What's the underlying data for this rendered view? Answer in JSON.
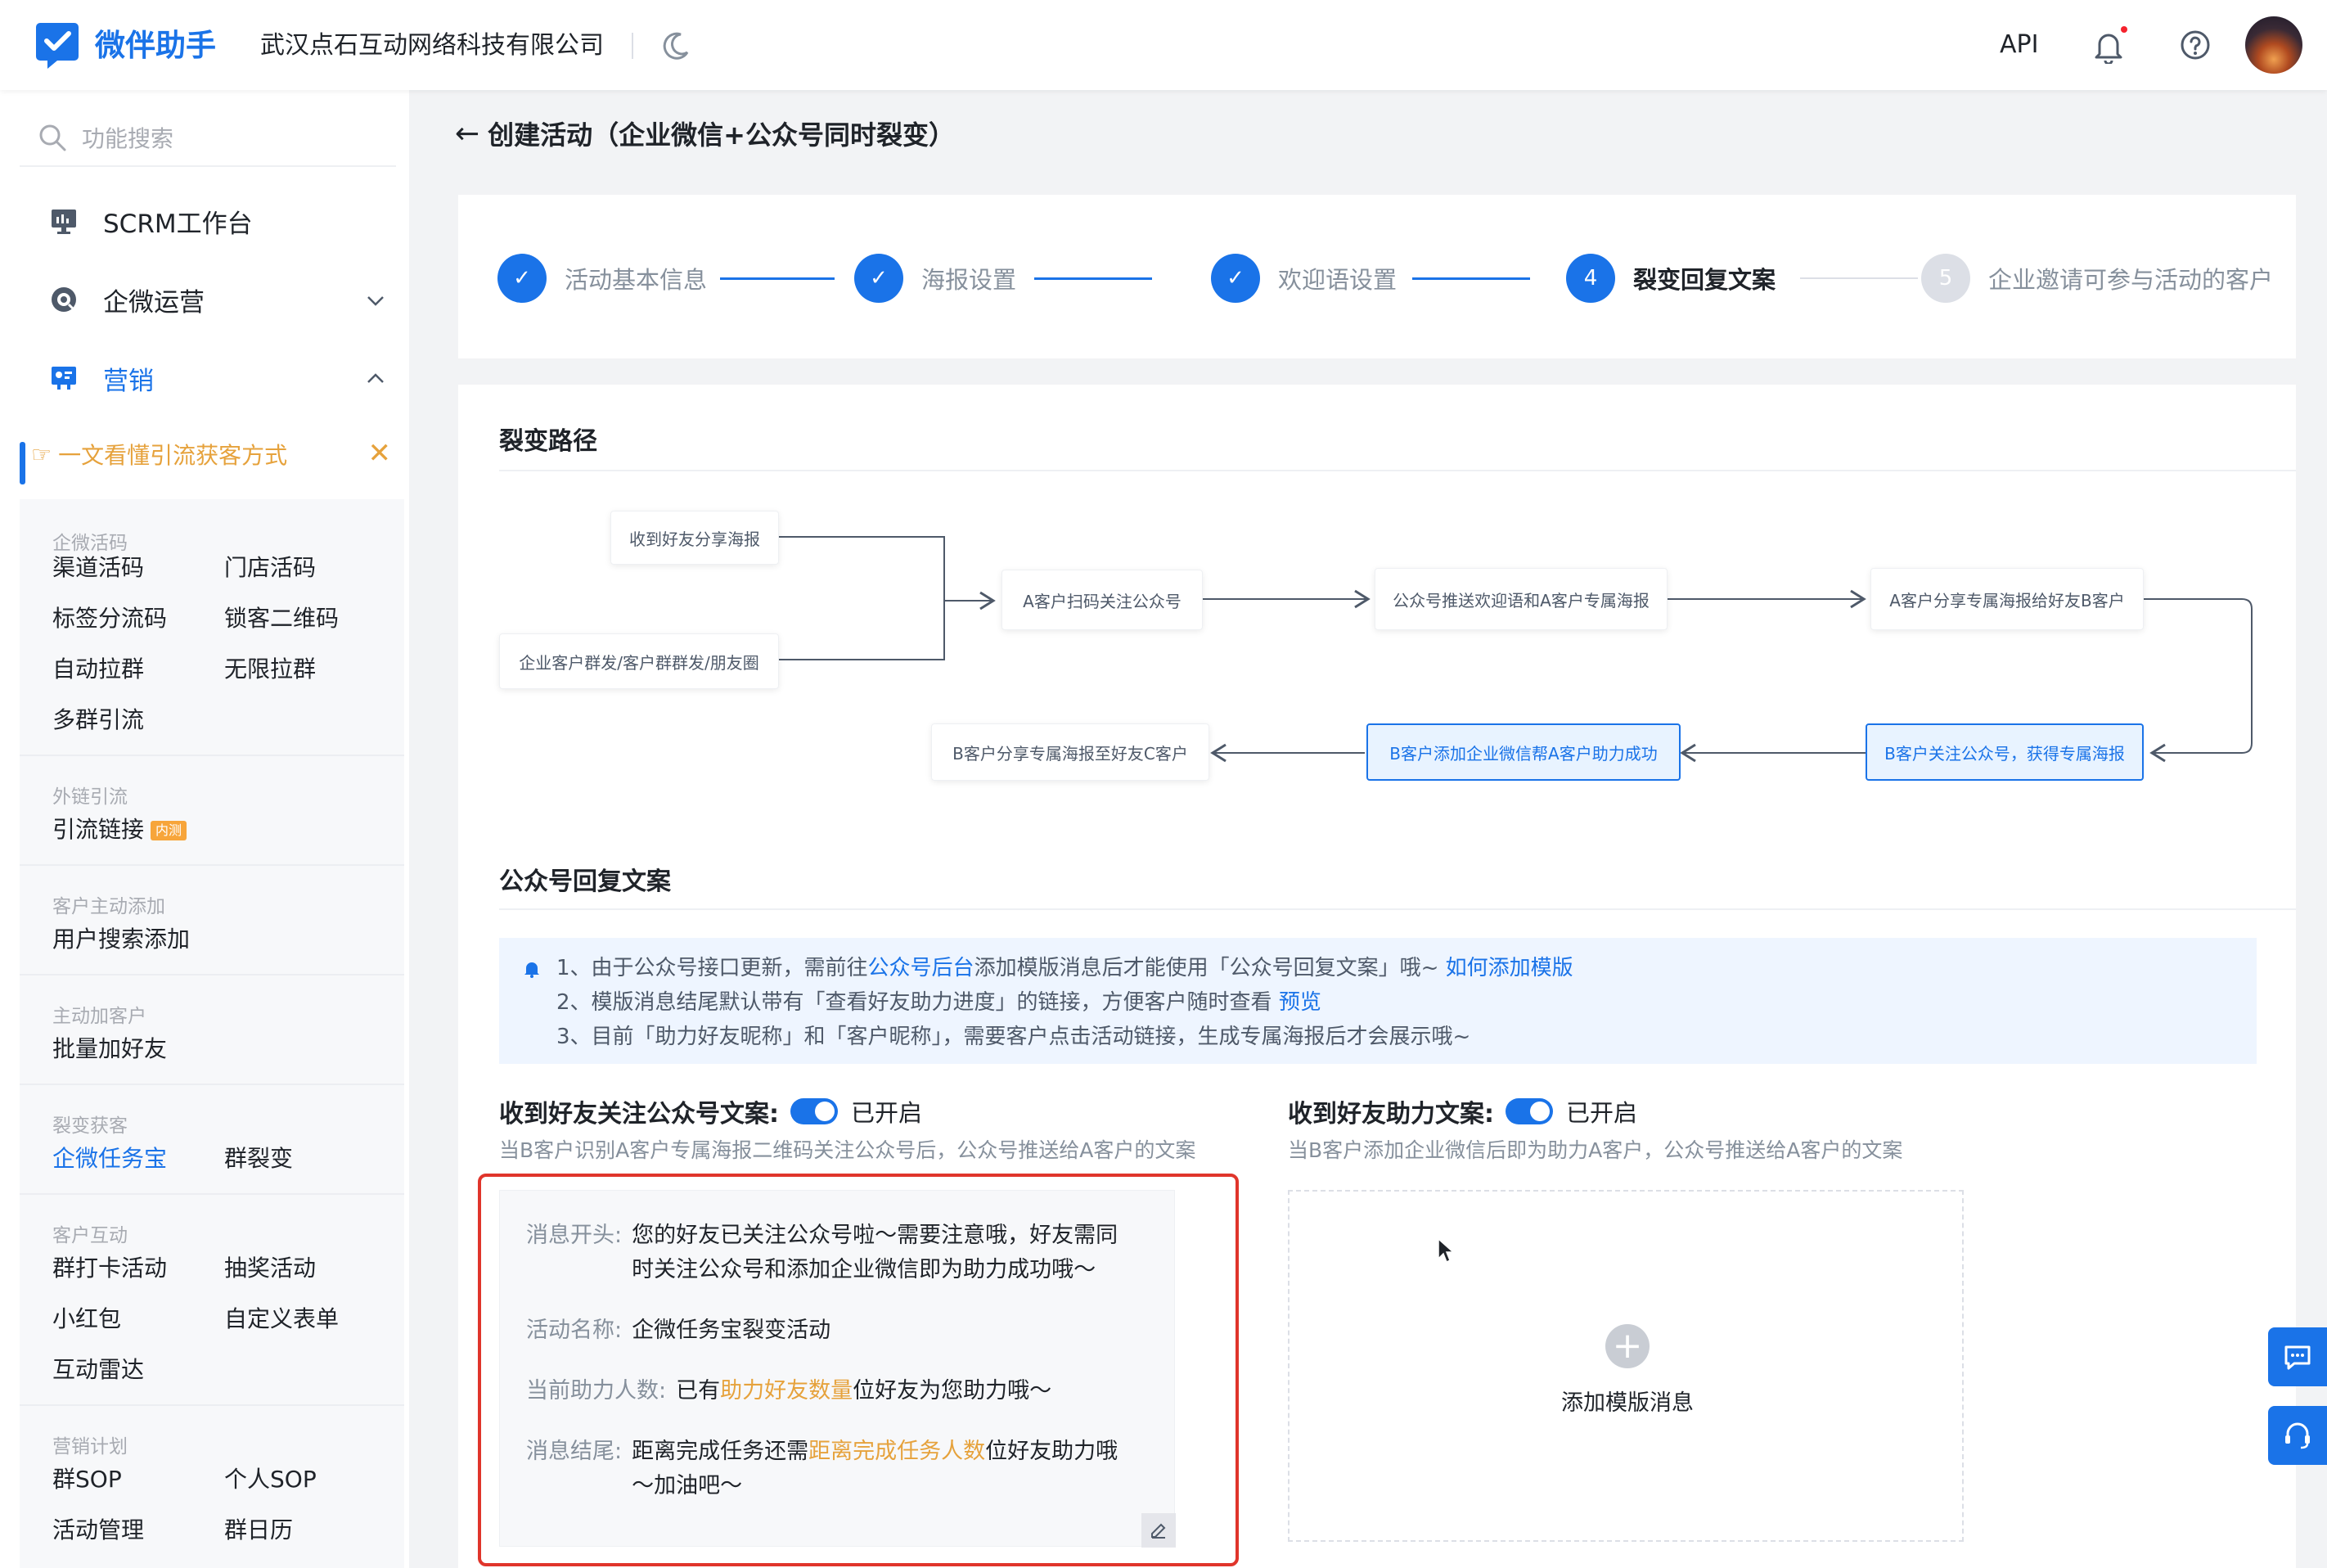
{
  "header": {
    "brand": "微伴助手",
    "company": "武汉点石互动网络科技有限公司",
    "api_label": "API",
    "accent_color": "#1a73e8"
  },
  "sidebar": {
    "search_placeholder": "功能搜索",
    "items": [
      {
        "label": "SCRM工作台",
        "icon": "monitor-icon"
      },
      {
        "label": "企微运营",
        "icon": "chat-icon"
      },
      {
        "label": "营销",
        "icon": "marketing-icon"
      }
    ],
    "promo": "一文看懂引流获客方式",
    "groups": [
      {
        "title": "企微活码",
        "items": [
          "渠道活码",
          "门店活码",
          "标签分流码",
          "锁客二维码",
          "自动拉群",
          "无限拉群",
          "多群引流"
        ]
      },
      {
        "title": "外链引流",
        "items": [
          "引流链接"
        ],
        "badge": "内测"
      },
      {
        "title": "客户主动添加",
        "items": [
          "用户搜索添加"
        ]
      },
      {
        "title": "主动加客户",
        "items": [
          "批量加好友"
        ]
      },
      {
        "title": "裂变获客",
        "items": [
          "企微任务宝",
          "群裂变"
        ]
      },
      {
        "title": "客户互动",
        "items": [
          "群打卡活动",
          "抽奖活动",
          "小红包",
          "自定义表单",
          "互动雷达"
        ]
      },
      {
        "title": "营销计划",
        "items": [
          "群SOP",
          "个人SOP",
          "活动管理",
          "群日历"
        ]
      }
    ]
  },
  "page": {
    "title": "创建活动（企业微信+公众号同时裂变）"
  },
  "steps": [
    {
      "label": "活动基本信息",
      "status": "done"
    },
    {
      "label": "海报设置",
      "status": "done"
    },
    {
      "label": "欢迎语设置",
      "status": "done"
    },
    {
      "label": "裂变回复文案",
      "status": "current",
      "number": "4"
    },
    {
      "label": "企业邀请可参与活动的客户",
      "status": "pending",
      "number": "5"
    }
  ],
  "flow": {
    "section_title": "裂变路径",
    "nodes": {
      "n1": "收到好友分享海报",
      "n2": "企业客户群发/客户群群发/朋友圈",
      "n3": "A客户扫码关注公众号",
      "n4": "公众号推送欢迎语和A客户专属海报",
      "n5": "A客户分享专属海报给好友B客户",
      "n6": "B客户关注公众号，获得专属海报",
      "n7": "B客户添加企业微信帮A客户助力成功",
      "n8": "B客户分享专属海报至好友C客户"
    }
  },
  "reply": {
    "section_title": "公众号回复文案",
    "notice": {
      "l1_a": "1、由于公众号接口更新，需前往",
      "l1_link": "公众号后台",
      "l1_b": "添加模版消息后才能使用「公众号回复文案」哦~ ",
      "l1_link2": "如何添加模版",
      "l2_a": "2、模版消息结尾默认带有「查看好友助力进度」的链接，方便客户随时查看 ",
      "l2_link": "预览",
      "l3": "3、目前「助力好友昵称」和「客户昵称」，需要客户点击活动链接，生成专属海报后才会展示哦~"
    },
    "follow": {
      "title": "收到好友关注公众号文案:",
      "toggle": "已开启",
      "desc": "当B客户识别A客户专属海报二维码关注公众号后，公众号推送给A客户的文案",
      "rows": {
        "open_k": "消息开头:",
        "open_v": "您的好友已关注公众号啦～需要注意哦，好友需同时关注公众号和添加企业微信即为助力成功哦～",
        "name_k": "活动名称:",
        "name_v": "企微任务宝裂变活动",
        "count_k": "当前助力人数:",
        "count_a": "已有",
        "count_hl": "助力好友数量",
        "count_b": "位好友为您助力哦～",
        "end_k": "消息结尾:",
        "end_a": "距离完成任务还需",
        "end_hl": "距离完成任务人数",
        "end_b": "位好友助力哦～加油吧～"
      }
    },
    "assist": {
      "title": "收到好友助力文案:",
      "toggle": "已开启",
      "desc": "当B客户添加企业微信后即为助力A客户，公众号推送给A客户的文案",
      "add_label": "添加模版消息"
    }
  }
}
